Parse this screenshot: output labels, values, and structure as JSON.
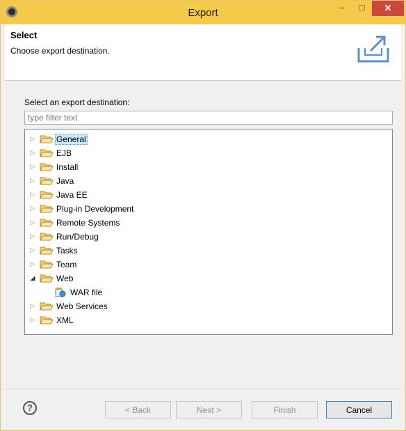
{
  "window": {
    "title": "Export",
    "min_glyph": "–",
    "max_glyph": "□",
    "close_glyph": "✕"
  },
  "header": {
    "title": "Select",
    "subtitle": "Choose export destination."
  },
  "body": {
    "destination_label": "Select an export destination:",
    "filter": {
      "placeholder": "type filter text",
      "value": ""
    }
  },
  "tree": {
    "items": [
      {
        "label": "General",
        "expanded": false,
        "selected": true
      },
      {
        "label": "EJB",
        "expanded": false
      },
      {
        "label": "Install",
        "expanded": false
      },
      {
        "label": "Java",
        "expanded": false
      },
      {
        "label": "Java EE",
        "expanded": false
      },
      {
        "label": "Plug-in Development",
        "expanded": false
      },
      {
        "label": "Remote Systems",
        "expanded": false
      },
      {
        "label": "Run/Debug",
        "expanded": false
      },
      {
        "label": "Tasks",
        "expanded": false
      },
      {
        "label": "Team",
        "expanded": false
      },
      {
        "label": "Web",
        "expanded": true,
        "children": [
          {
            "label": "WAR file"
          }
        ]
      },
      {
        "label": "Web Services",
        "expanded": false
      },
      {
        "label": "XML",
        "expanded": false
      }
    ]
  },
  "footer": {
    "help_glyph": "?",
    "back_label": "< Back",
    "next_label": "Next >",
    "finish_label": "Finish",
    "cancel_label": "Cancel"
  },
  "colors": {
    "titlebar": "#f5c94a",
    "close_button": "#c94a3b",
    "selection": "#cce8ff",
    "folder": "#e8b84a"
  },
  "icons": {
    "app": "eclipse-icon",
    "header": "export-icon",
    "folder": "folder-open-icon",
    "leaf": "war-file-icon",
    "collapsed": "triangle-right-icon",
    "expanded": "triangle-down-icon"
  }
}
